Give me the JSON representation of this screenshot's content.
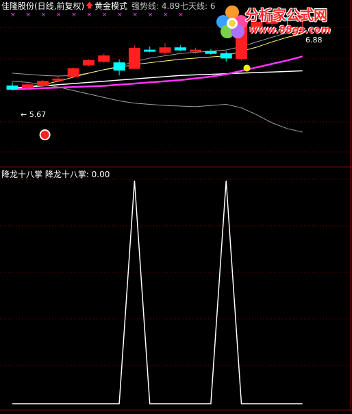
{
  "header": {
    "title": "佳隆股份(日线,前复权)",
    "mode_arrow": "🡅",
    "mode": "黄金模式",
    "strong_line": "强势线: 4.89",
    "seven_day_line": "七天线: 6"
  },
  "watermark": {
    "name": "分析家公式网",
    "url": "www.88gs.com",
    "icon": "flower-logo-icon"
  },
  "price_labels": {
    "high": "6.88",
    "low": "← 5.67"
  },
  "sub_panel": {
    "title": "降龙十八掌 降龙十八掌: 0.00"
  },
  "colors": {
    "background": "#000000",
    "grid": "#8b0000",
    "up_candle": "#ff2020",
    "down_candle": "#00ffff",
    "ma_white": "#ffffff",
    "ma_yellow": "#ffff80",
    "ma_magenta": "#ff33ff",
    "ma_gray": "#a0a0a0",
    "marker_x": "#ff40ff",
    "signal_line": "#ffffff"
  },
  "chart_data": [
    {
      "type": "candlestick",
      "title": "佳隆股份(日线,前复权)",
      "ylim": [
        4.3,
        7.0
      ],
      "candles": [
        {
          "o": 5.68,
          "h": 5.74,
          "l": 5.6,
          "c": 5.62,
          "dir": "down"
        },
        {
          "o": 5.65,
          "h": 5.72,
          "l": 5.62,
          "c": 5.7,
          "dir": "up"
        },
        {
          "o": 5.68,
          "h": 5.78,
          "l": 5.66,
          "c": 5.76,
          "dir": "up"
        },
        {
          "o": 5.78,
          "h": 5.84,
          "l": 5.75,
          "c": 5.8,
          "dir": "up"
        },
        {
          "o": 5.84,
          "h": 6.0,
          "l": 5.83,
          "c": 5.98,
          "dir": "up"
        },
        {
          "o": 6.04,
          "h": 6.14,
          "l": 6.02,
          "c": 6.12,
          "dir": "up"
        },
        {
          "o": 6.1,
          "h": 6.24,
          "l": 6.08,
          "c": 6.2,
          "dir": "up"
        },
        {
          "o": 6.08,
          "h": 6.14,
          "l": 5.86,
          "c": 5.95,
          "dir": "down"
        },
        {
          "o": 5.98,
          "h": 6.38,
          "l": 5.98,
          "c": 6.33,
          "dir": "up"
        },
        {
          "o": 6.3,
          "h": 6.36,
          "l": 6.26,
          "c": 6.28,
          "dir": "down"
        },
        {
          "o": 6.26,
          "h": 6.42,
          "l": 6.22,
          "c": 6.34,
          "dir": "up"
        },
        {
          "o": 6.34,
          "h": 6.38,
          "l": 6.28,
          "c": 6.3,
          "dir": "down"
        },
        {
          "o": 6.28,
          "h": 6.34,
          "l": 6.24,
          "c": 6.3,
          "dir": "up"
        },
        {
          "o": 6.28,
          "h": 6.32,
          "l": 6.22,
          "c": 6.24,
          "dir": "down"
        },
        {
          "o": 6.24,
          "h": 6.28,
          "l": 6.1,
          "c": 6.16,
          "dir": "down"
        },
        {
          "o": 6.15,
          "h": 6.82,
          "l": 6.12,
          "c": 6.75,
          "dir": "up"
        },
        {
          "o": 6.7,
          "h": 6.8,
          "l": 6.65,
          "c": 6.78,
          "dir": "up"
        },
        {
          "o": 6.76,
          "h": 6.92,
          "l": 6.72,
          "c": 6.88,
          "dir": "up"
        },
        {
          "o": 6.86,
          "h": 6.9,
          "l": 6.72,
          "c": 6.82,
          "dir": "down"
        },
        {
          "o": 6.82,
          "h": 6.88,
          "l": 6.62,
          "c": 6.88,
          "dir": "up"
        }
      ],
      "ma_white": [
        5.64,
        5.66,
        5.68,
        5.7,
        5.72,
        5.74,
        5.76,
        5.78,
        5.8,
        5.82,
        5.84,
        5.86,
        5.87,
        5.88,
        5.89,
        5.9,
        5.91,
        5.92,
        5.93,
        5.94
      ],
      "ma_yellow": [
        5.62,
        5.66,
        5.7,
        5.76,
        5.83,
        5.9,
        5.96,
        6.0,
        6.05,
        6.08,
        6.11,
        6.14,
        6.16,
        6.18,
        6.2,
        6.28,
        6.35,
        6.44,
        6.52,
        6.58
      ],
      "ma_magenta": [
        5.62,
        5.63,
        5.64,
        5.65,
        5.66,
        5.67,
        5.68,
        5.7,
        5.72,
        5.74,
        5.76,
        5.78,
        5.81,
        5.84,
        5.88,
        5.94,
        6.0,
        6.06,
        6.12,
        6.19
      ],
      "ma_gray_upper": [
        5.9,
        5.88,
        5.86,
        5.85,
        5.86,
        5.9,
        5.96,
        6.02,
        6.1,
        6.16,
        6.2,
        6.24,
        6.26,
        6.28,
        6.3,
        6.36,
        6.44,
        6.52,
        6.6,
        6.66
      ],
      "ma_gray_lower": [
        5.76,
        5.74,
        5.7,
        5.66,
        5.6,
        5.54,
        5.48,
        5.42,
        5.38,
        5.36,
        5.34,
        5.33,
        5.32,
        5.34,
        5.36,
        5.3,
        5.18,
        5.04,
        4.94,
        4.88
      ],
      "marker_x_count": 12,
      "signal_dot_index": 15,
      "buy_marker_index": 2
    },
    {
      "type": "line",
      "title": "降龙十八掌",
      "ylim": [
        0,
        100
      ],
      "values": [
        0,
        0,
        0,
        0,
        0,
        0,
        0,
        0,
        100,
        0,
        0,
        0,
        0,
        0,
        100,
        0,
        0,
        0,
        0,
        0
      ]
    }
  ]
}
